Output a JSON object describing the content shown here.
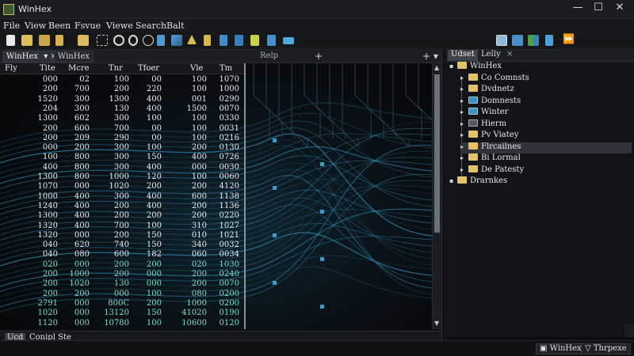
{
  "window": {
    "title": "WinHex",
    "min_glyph": "—",
    "max_glyph": "☐",
    "close_glyph": "✕"
  },
  "menu": [
    "File",
    "View",
    "Been",
    "Fsvue",
    "Viewe",
    "Search",
    "Balt"
  ],
  "toolbar_icons": [
    "new-file-icon",
    "open-folder-icon",
    "save-icon",
    "copy-icon",
    "paste-icon",
    "select-icon",
    "search-icon",
    "find-icon",
    "replace-icon",
    "link-icon",
    "image-icon",
    "text-icon",
    "tools-icon",
    "pin-icon",
    "magnet-icon",
    "network-icon",
    "display-icon",
    "window-icon",
    "window2-icon",
    "puzzle-icon",
    "grid-icon",
    "forward-icon"
  ],
  "left_tabs": {
    "tab1": "WinHex",
    "tab1_ctl": "▾ ×",
    "tab2": "WinHex",
    "relp": "Relp",
    "plus": "+",
    "right_ctls": "+ ▾"
  },
  "columns": [
    "Fly",
    "Tite",
    "Mcre",
    "Tnr",
    "Tfoer",
    "Vle",
    "Tm"
  ],
  "rows": [
    [
      "000",
      "02",
      "100",
      "00",
      "100",
      "1070"
    ],
    [
      "200",
      "700",
      "200",
      "220",
      "100",
      "1000"
    ],
    [
      "1520",
      "300",
      "1300",
      "400",
      "001",
      "0290"
    ],
    [
      "204",
      "300",
      "130",
      "400",
      "1500",
      "0070"
    ],
    [
      "1300",
      "602",
      "300",
      "100",
      "100",
      "0330"
    ],
    [
      "200",
      "600",
      "700",
      "00",
      "100",
      "0031"
    ],
    [
      "200",
      "209",
      "290",
      "00",
      "100",
      "0216"
    ],
    [
      "000",
      "200",
      "300",
      "100",
      "200",
      "0130"
    ],
    [
      "100",
      "800",
      "300",
      "150",
      "400",
      "0726"
    ],
    [
      "400",
      "800",
      "300",
      "400",
      "000",
      "0030"
    ],
    [
      "1300",
      "800",
      "1000",
      "120",
      "100",
      "0060"
    ],
    [
      "1070",
      "000",
      "1020",
      "200",
      "200",
      "4120"
    ],
    [
      "1000",
      "400",
      "300",
      "400",
      "600",
      "1138"
    ],
    [
      "1240",
      "400",
      "200",
      "400",
      "200",
      "1136"
    ],
    [
      "1300",
      "400",
      "200",
      "200",
      "200",
      "0220"
    ],
    [
      "1320",
      "400",
      "700",
      "100",
      "310",
      "1027"
    ],
    [
      "1320",
      "000",
      "200",
      "150",
      "010",
      "1021"
    ],
    [
      "040",
      "620",
      "740",
      "150",
      "340",
      "0032"
    ],
    [
      "040",
      "080",
      "600",
      "182",
      "060",
      "0034"
    ],
    [
      "020",
      "000",
      "200",
      "200",
      "020",
      "1030"
    ],
    [
      "200",
      "1000",
      "200",
      "000",
      "200",
      "0240"
    ],
    [
      "200",
      "1020",
      "130",
      "000",
      "200",
      "0070"
    ],
    [
      "200",
      "200",
      "000",
      "100",
      "080",
      "0200"
    ],
    [
      "2791",
      "000",
      "800C",
      "200",
      "1000",
      "0200"
    ],
    [
      "1020",
      "000",
      "13120",
      "150",
      "41020",
      "0190"
    ],
    [
      "1120",
      "000",
      "10780",
      "100",
      "10600",
      "0120"
    ]
  ],
  "right_tabs": {
    "tab1": "Udset",
    "tab2": "Lelly",
    "close": "×"
  },
  "tree": [
    {
      "label": "WinHex",
      "icon": "folder"
    },
    {
      "label": "Co Comnsts",
      "icon": "folder"
    },
    {
      "label": "Dvdnetz",
      "icon": "folder"
    },
    {
      "label": "Domnests",
      "icon": "folder-blue"
    },
    {
      "label": "Winter",
      "icon": "folder-blue"
    },
    {
      "label": "Hierm",
      "icon": "folder-dark"
    },
    {
      "label": "Pv Viatey",
      "icon": "folder"
    },
    {
      "label": "Flrcailnes",
      "icon": "folder"
    },
    {
      "label": "Bi Lormal",
      "icon": "folder"
    },
    {
      "label": "De Patesty",
      "icon": "folder"
    },
    {
      "label": "Drarnkes",
      "icon": "folder"
    }
  ],
  "bottom_tabs": [
    "Ucd",
    "Conipl Ste"
  ],
  "status": {
    "item1": "WinHex",
    "item2": "Thrpexe",
    "item2_glyph": "▽",
    "item1_glyph": "▣"
  },
  "colors": {
    "accent": "#3f8fc4",
    "folder": "#e2c36a",
    "circuit": "#2f8fb8"
  }
}
